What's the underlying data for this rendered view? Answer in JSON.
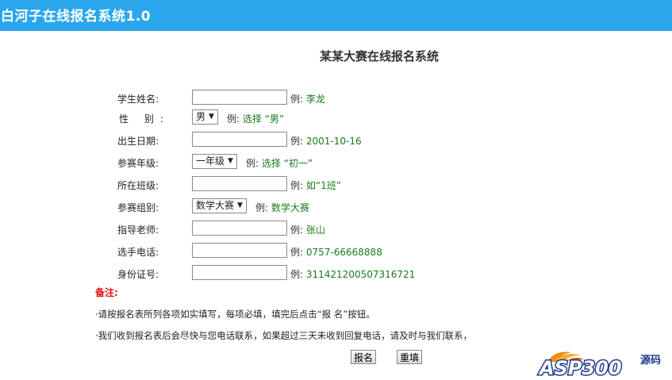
{
  "header": {
    "app_title": "白河子在线报名系统1.0"
  },
  "form": {
    "title": "某某大赛在线报名系统",
    "fields": {
      "name": {
        "label": "学生姓名:",
        "value": "",
        "hint_prefix": "例:",
        "hint_value": "李龙"
      },
      "gender": {
        "label": "性  别:",
        "selected": "男",
        "hint_prefix": "例:",
        "hint_value": "选择 “男”"
      },
      "birth": {
        "label": "出生日期:",
        "value": "",
        "hint_prefix": "例:",
        "hint_value": "2001-10-16"
      },
      "grade": {
        "label": "参赛年级:",
        "selected": "一年级",
        "hint_prefix": "例:",
        "hint_value": "选择 “初一”"
      },
      "class": {
        "label": "所在班级:",
        "value": "",
        "hint_prefix": "例:",
        "hint_value": "如“1班”"
      },
      "group": {
        "label": "参赛组别:",
        "selected": "数学大赛",
        "hint_prefix": "例:",
        "hint_value": "数学大赛"
      },
      "teacher": {
        "label": "指导老师:",
        "value": "",
        "hint_prefix": "例:",
        "hint_value": "张山"
      },
      "phone": {
        "label": "选手电话:",
        "value": "",
        "hint_prefix": "例:",
        "hint_value": "0757-66668888"
      },
      "id_card": {
        "label": "身份证号:",
        "value": "",
        "hint_prefix": "例:",
        "hint_value": "311421200507316721"
      }
    },
    "remarks": {
      "title": "备注:",
      "line1": "·请按报名表所列各项如实填写，每项必填，填完后点击“报 名”按钮。",
      "line2": "·我们收到报名表后会尽快与您电话联系，如果超过三天未收到回复电话，请及时与我们联系，"
    },
    "buttons": {
      "submit": "报名",
      "reset": "重填"
    }
  },
  "watermark": {
    "logo_text": "ASP300",
    "logo_suffix": "源码"
  },
  "colors": {
    "header_bg": "#2aa7ec",
    "hint_value": "#1a7a1a",
    "remark_title": "#dd1111"
  }
}
